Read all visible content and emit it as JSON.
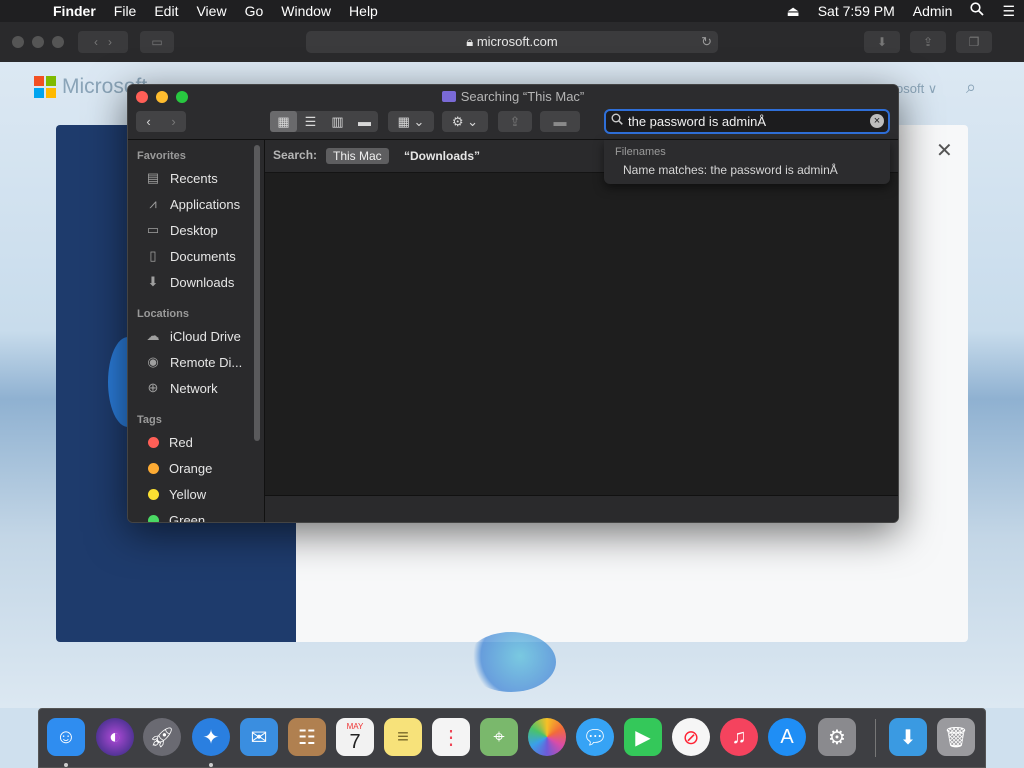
{
  "menubar": {
    "apple": "",
    "items": [
      "Finder",
      "File",
      "Edit",
      "View",
      "Go",
      "Window",
      "Help"
    ],
    "clock": "Sat 7:59 PM",
    "user": "Admin"
  },
  "browser": {
    "url": "microsoft.com",
    "brand": "Microsoft",
    "right_link": "osoft ∨"
  },
  "finder": {
    "title": "Searching “This Mac”",
    "search": {
      "value": "the password is adminÅ",
      "placeholder": "Search"
    },
    "scope": {
      "label": "Search:",
      "selected": "This Mac",
      "other": "“Downloads”"
    },
    "sidebar": {
      "favorites_header": "Favorites",
      "favorites": [
        "Recents",
        "Applications",
        "Desktop",
        "Documents",
        "Downloads"
      ],
      "locations_header": "Locations",
      "locations": [
        "iCloud Drive",
        "Remote Di...",
        "Network"
      ],
      "tags_header": "Tags",
      "tags": [
        {
          "label": "Red",
          "color": "#ff5f57"
        },
        {
          "label": "Orange",
          "color": "#fdab34"
        },
        {
          "label": "Yellow",
          "color": "#fbe032"
        },
        {
          "label": "Green",
          "color": "#4ad964"
        }
      ]
    },
    "suggestions": {
      "header": "Filenames",
      "row": "Name matches: the password is adminÅ"
    }
  },
  "dock": {
    "apps": [
      {
        "name": "finder",
        "color": "#2f8df0"
      },
      {
        "name": "siri",
        "color": "#2b2b6e"
      },
      {
        "name": "launchpad",
        "color": "#6a6a72"
      },
      {
        "name": "safari",
        "color": "#2a7fe0"
      },
      {
        "name": "mail",
        "color": "#3a8ee0"
      },
      {
        "name": "contacts",
        "color": "#b08050"
      },
      {
        "name": "calendar",
        "color": "#f2f2f2",
        "month": "MAY",
        "day": "7"
      },
      {
        "name": "notes",
        "color": "#f7e27a"
      },
      {
        "name": "reminders",
        "color": "#f4f4f4"
      },
      {
        "name": "maps",
        "color": "#7ab86c"
      },
      {
        "name": "photos",
        "color": "#f4f4f4"
      },
      {
        "name": "messages",
        "color": "#36a3f5"
      },
      {
        "name": "facetime",
        "color": "#34c85a"
      },
      {
        "name": "news",
        "color": "#f6f6f6"
      },
      {
        "name": "music",
        "color": "#f5435e"
      },
      {
        "name": "app-store",
        "color": "#1f8ef5"
      },
      {
        "name": "system-preferences",
        "color": "#8a8a8e"
      },
      {
        "name": "downloads-folder",
        "color": "#3a9ae2"
      },
      {
        "name": "trash",
        "color": "#9a9a9e"
      }
    ]
  }
}
